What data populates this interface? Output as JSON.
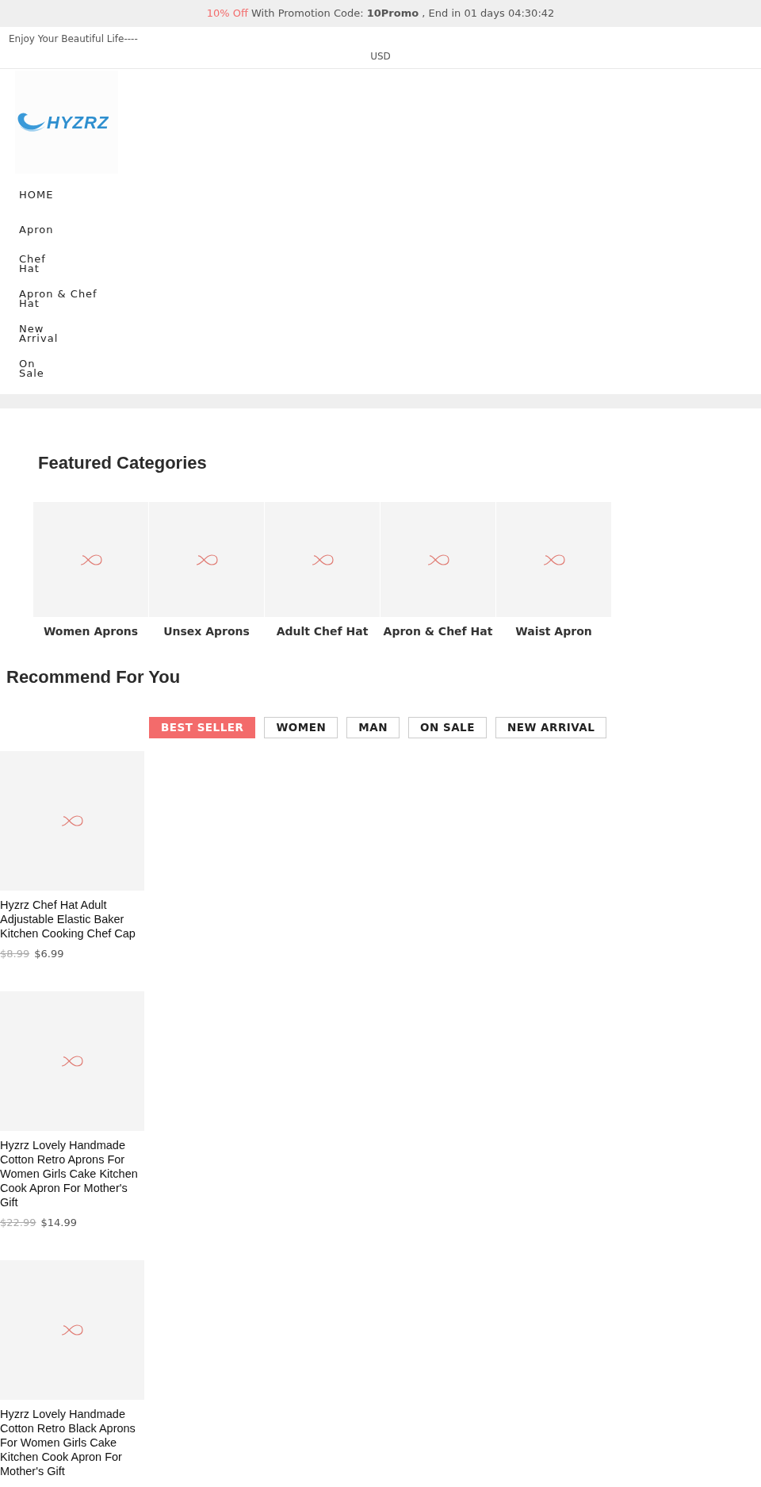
{
  "promo": {
    "highlight": "10% Off",
    "text": "With Promotion Code: **10Promo** , End in 01 days 04:30:42"
  },
  "header": {
    "tagline": "Enjoy Your Beautiful Life----",
    "currency": "USD"
  },
  "logo": {
    "text": "HYZRZ"
  },
  "nav": [
    {
      "lines": [
        "HOME"
      ]
    },
    {
      "lines": [
        "Apron"
      ]
    },
    {
      "lines": [
        "Chef",
        "Hat"
      ]
    },
    {
      "lines": [
        "Apron & Chef",
        "Hat"
      ]
    },
    {
      "lines": [
        "New",
        "Arrival"
      ]
    },
    {
      "lines": [
        "On",
        "Sale"
      ]
    }
  ],
  "featured": {
    "title": "Featured Categories",
    "categories": [
      {
        "label": "Women Aprons"
      },
      {
        "label": "Unsex Aprons"
      },
      {
        "label": "Adult Chef Hat"
      },
      {
        "label": "Apron & Chef Hat"
      },
      {
        "label": "Waist Apron"
      }
    ]
  },
  "recommend": {
    "title": "Recommend For You",
    "tabs": [
      {
        "label": "BEST SELLER",
        "selected": true
      },
      {
        "label": "WOMEN",
        "selected": false
      },
      {
        "label": "MAN",
        "selected": false
      },
      {
        "label": "ON SALE",
        "selected": false
      },
      {
        "label": "NEW ARRIVAL",
        "selected": false
      }
    ],
    "products": [
      {
        "title": "Hyzrz Chef Hat Adult Adjustable Elastic Baker Kitchen Cooking Chef Cap",
        "old_price": "$8.99",
        "price": "$6.99"
      },
      {
        "title": "Hyzrz Lovely Handmade Cotton Retro Aprons For Women Girls Cake Kitchen Cook Apron For Mother's Gift",
        "old_price": "$22.99",
        "price": "$14.99"
      },
      {
        "title": "Hyzrz Lovely Handmade Cotton Retro Black Aprons For Women Girls Cake Kitchen Cook Apron For Mother's Gift"
      }
    ]
  }
}
